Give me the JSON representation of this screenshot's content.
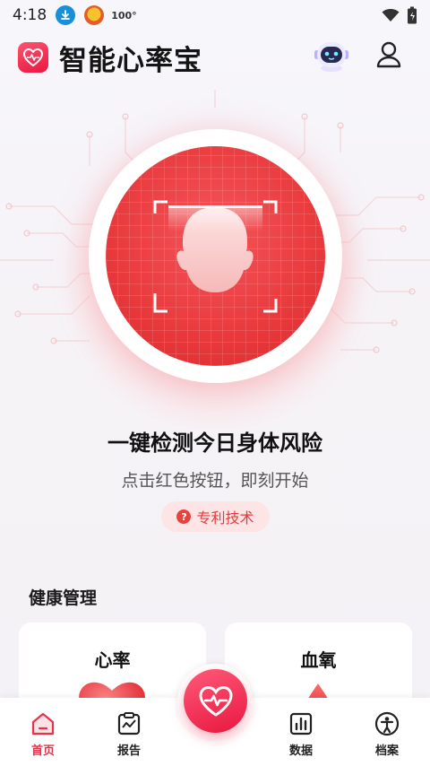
{
  "status_bar": {
    "time": "4:18",
    "temp_text": "100°",
    "icons": [
      "download-icon",
      "app-notification-icon",
      "wifi-icon",
      "battery-icon"
    ]
  },
  "header": {
    "title": "智能心率宝",
    "icons": [
      "heart-logo-icon",
      "robot-assistant-icon",
      "profile-icon"
    ]
  },
  "hero": {
    "title": "一键检测今日身体风险",
    "subtitle": "点击红色按钮，即刻开始",
    "patent_label": "专利技术",
    "patent_icon_text": "?",
    "accent_color": "#e83a3d"
  },
  "health": {
    "section_title": "健康管理",
    "cards": [
      {
        "label": "心率"
      },
      {
        "label": "血氧"
      }
    ]
  },
  "nav": {
    "items": [
      {
        "label": "首页",
        "icon": "home-icon",
        "active": true
      },
      {
        "label": "报告",
        "icon": "report-icon",
        "active": false
      },
      {
        "label": "数据",
        "icon": "data-chart-icon",
        "active": false
      },
      {
        "label": "档案",
        "icon": "person-profile-icon",
        "active": false
      }
    ],
    "center_icon": "heart-pulse-icon",
    "accent_color": "#e8324a"
  }
}
